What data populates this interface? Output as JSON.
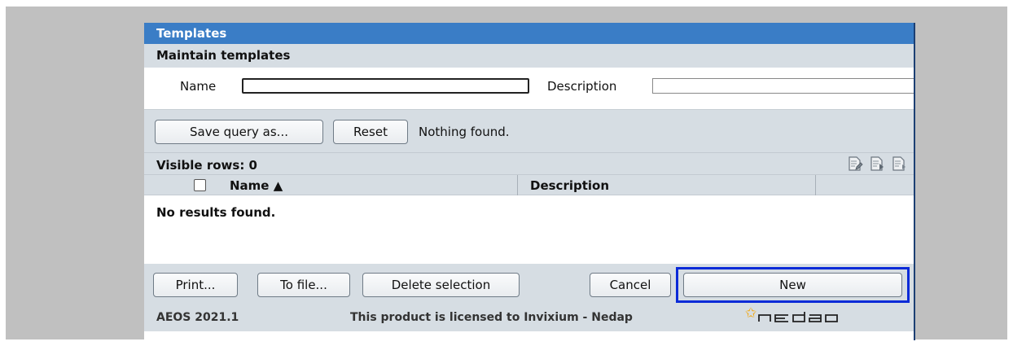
{
  "window": {
    "title": "Templates",
    "subtitle": "Maintain templates"
  },
  "filters": {
    "name_label": "Name",
    "name_value": "",
    "description_label": "Description",
    "description_value": ""
  },
  "query_bar": {
    "save_query_label": "Save query as...",
    "reset_label": "Reset",
    "status": "Nothing found."
  },
  "rows_bar": {
    "visible_rows": "Visible rows: 0",
    "icons": [
      "edit-list-icon",
      "export-list-icon",
      "column-settings-icon"
    ]
  },
  "table": {
    "columns": [
      {
        "label": "Name ▲",
        "sorted": "ascending"
      },
      {
        "label": "Description"
      }
    ],
    "empty_message": "No results found."
  },
  "actions": {
    "print_label": "Print...",
    "to_file_label": "To file...",
    "delete_selection_label": "Delete selection",
    "cancel_label": "Cancel",
    "new_label": "New"
  },
  "footer": {
    "version": "AEOS 2021.1",
    "license": "This product is licensed to Invixium - Nedap",
    "logo_icon": "nedap-logo-icon"
  },
  "colors": {
    "title_bar": "#3a7dc6",
    "section_bg": "#d6dde3",
    "highlight": "#0a2ad8",
    "logo_star": "#f2a60c"
  }
}
